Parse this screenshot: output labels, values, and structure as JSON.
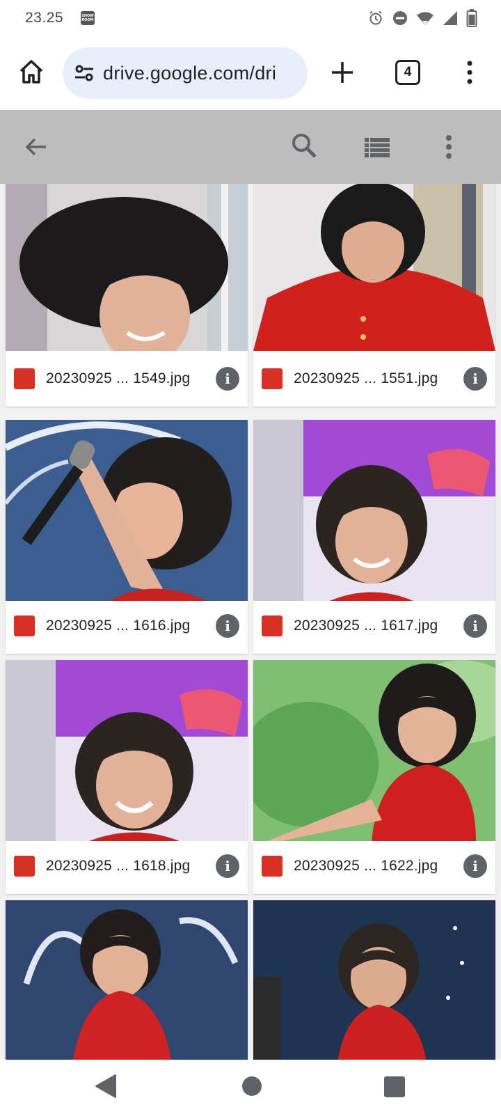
{
  "status_bar": {
    "time": "23.25",
    "app_icon": "showroom-icon",
    "icons": [
      "alarm-icon",
      "do-not-disturb-icon",
      "wifi-icon",
      "cell-signal-icon",
      "battery-icon"
    ]
  },
  "browser": {
    "url": "drive.google.com/dri",
    "tab_count": "4",
    "icons": [
      "home-icon",
      "site-settings-icon",
      "new-tab-icon",
      "tab-switcher-icon",
      "overflow-menu-icon"
    ]
  },
  "drive_toolbar": {
    "icons": [
      "back-arrow-icon",
      "search-icon",
      "list-view-icon",
      "more-vert-icon"
    ]
  },
  "files": [
    {
      "name": "20230925 ... 1549.jpg",
      "thumb": "jacket-portrait-hair-flip"
    },
    {
      "name": "20230925 ... 1551.jpg",
      "thumb": "red-jacket-portrait"
    },
    {
      "name": "20230925 ... 1616.jpg",
      "thumb": "holding-microphone"
    },
    {
      "name": "20230925 ... 1617.jpg",
      "thumb": "smiling-purple-background"
    },
    {
      "name": "20230925 ... 1618.jpg",
      "thumb": "laughing-purple-background"
    },
    {
      "name": "20230925 ... 1622.jpg",
      "thumb": "dancing-green-background"
    },
    {
      "name": "",
      "thumb": "red-dress-stage"
    },
    {
      "name": "",
      "thumb": "red-dress-dark-stage"
    }
  ],
  "nav_bar": {
    "icons": [
      "nav-back-icon",
      "nav-home-icon",
      "nav-recents-icon"
    ]
  },
  "colors": {
    "toolbar_bg": "#bdbdbd",
    "url_bg": "#e9effa",
    "image_badge": "#d93025",
    "grid_bg": "#f1f1f1"
  }
}
